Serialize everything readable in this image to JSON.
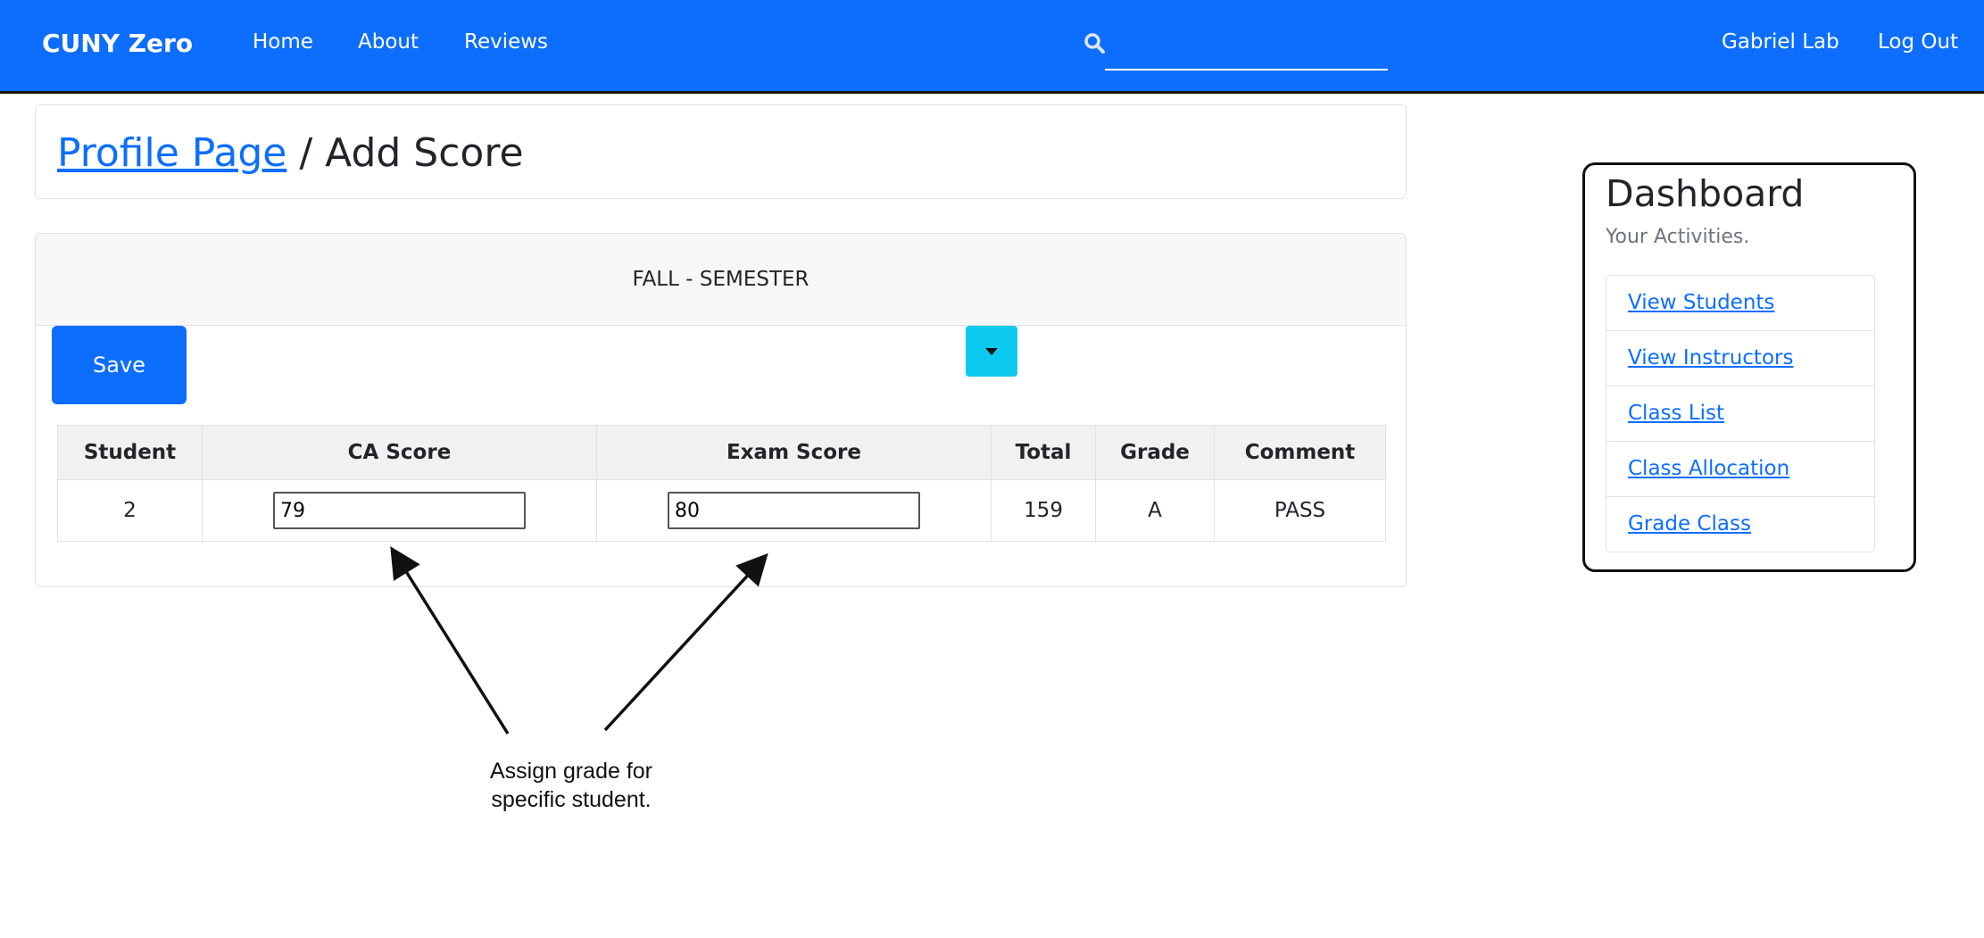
{
  "nav": {
    "brand": "CUNY Zero",
    "links": [
      "Home",
      "About",
      "Reviews"
    ],
    "search_value": "",
    "user": "Gabriel Lab",
    "logout": "Log Out"
  },
  "breadcrumb": {
    "parent": "Profile Page",
    "separator": " / ",
    "current": "Add Score"
  },
  "score_card": {
    "header": "FALL - SEMESTER",
    "save_label": "Save",
    "columns": [
      "Student",
      "CA Score",
      "Exam Score",
      "Total",
      "Grade",
      "Comment"
    ],
    "rows": [
      {
        "student": "2",
        "ca_score": "79",
        "exam_score": "80",
        "total": "159",
        "grade": "A",
        "comment": "PASS"
      }
    ]
  },
  "annotation": {
    "line1": "Assign grade for",
    "line2": "specific student."
  },
  "dashboard": {
    "title": "Dashboard",
    "subtitle": "Your Activities.",
    "items": [
      "View Students",
      "View Instructors",
      "Class List",
      "Class Allocation",
      "Grade Class"
    ]
  },
  "colors": {
    "primary": "#0d6efd",
    "info": "#0dcaf0",
    "header_bg": "#f7f7f7"
  }
}
